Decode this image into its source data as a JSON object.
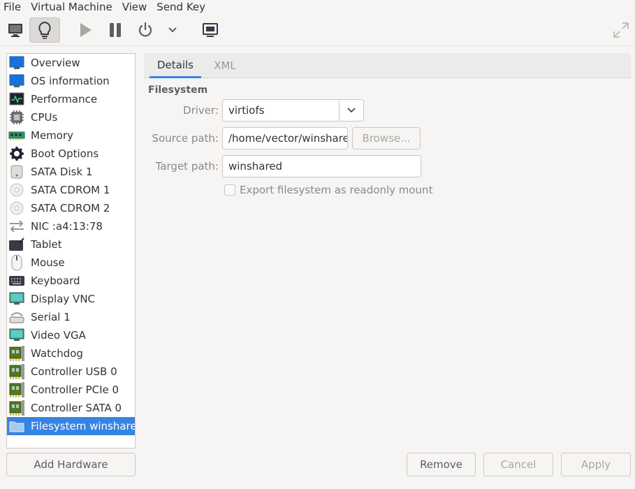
{
  "menubar": {
    "items": [
      "File",
      "Virtual Machine",
      "View",
      "Send Key"
    ]
  },
  "toolbar": {
    "icons": [
      "monitor-icon",
      "lightbulb-icon",
      "play-icon",
      "pause-icon",
      "power-icon",
      "chevron-down-icon",
      "screenshot-icon",
      "fullscreen-icon"
    ],
    "active": "details-view"
  },
  "sidebar": {
    "items": [
      {
        "label": "Overview",
        "icon": "monitor-icon"
      },
      {
        "label": "OS information",
        "icon": "monitor-icon"
      },
      {
        "label": "Performance",
        "icon": "performance-icon"
      },
      {
        "label": "CPUs",
        "icon": "cpu-icon"
      },
      {
        "label": "Memory",
        "icon": "memory-icon"
      },
      {
        "label": "Boot Options",
        "icon": "gear-icon"
      },
      {
        "label": "SATA Disk 1",
        "icon": "disk-icon"
      },
      {
        "label": "SATA CDROM 1",
        "icon": "cdrom-icon"
      },
      {
        "label": "SATA CDROM 2",
        "icon": "cdrom-icon"
      },
      {
        "label": "NIC :a4:13:78",
        "icon": "network-icon"
      },
      {
        "label": "Tablet",
        "icon": "tablet-icon"
      },
      {
        "label": "Mouse",
        "icon": "mouse-icon"
      },
      {
        "label": "Keyboard",
        "icon": "keyboard-icon"
      },
      {
        "label": "Display VNC",
        "icon": "display-icon"
      },
      {
        "label": "Serial 1",
        "icon": "serial-icon"
      },
      {
        "label": "Video VGA",
        "icon": "display-icon"
      },
      {
        "label": "Watchdog",
        "icon": "pci-card-icon"
      },
      {
        "label": "Controller USB 0",
        "icon": "pci-card-icon"
      },
      {
        "label": "Controller PCIe 0",
        "icon": "pci-card-icon"
      },
      {
        "label": "Controller SATA 0",
        "icon": "pci-card-icon"
      },
      {
        "label": "Filesystem winshare",
        "icon": "folder-icon"
      }
    ],
    "selected_index": 20
  },
  "tabs": [
    {
      "label": "Details",
      "active": true
    },
    {
      "label": "XML",
      "active": false
    }
  ],
  "details": {
    "section_title": "Filesystem",
    "driver_label": "Driver:",
    "driver_value": "virtiofs",
    "source_label": "Source path:",
    "source_value": "/home/vector/winshare",
    "browse_label": "Browse...",
    "target_label": "Target path:",
    "target_value": "winshared",
    "readonly_label": "Export filesystem as readonly mount",
    "readonly_checked": false
  },
  "footer": {
    "add_hardware": "Add Hardware",
    "remove": "Remove",
    "cancel": "Cancel",
    "apply": "Apply"
  },
  "colors": {
    "accent": "#3584e4",
    "window_bg": "#f6f5f4",
    "disabled_text": "#a8a7a4"
  }
}
